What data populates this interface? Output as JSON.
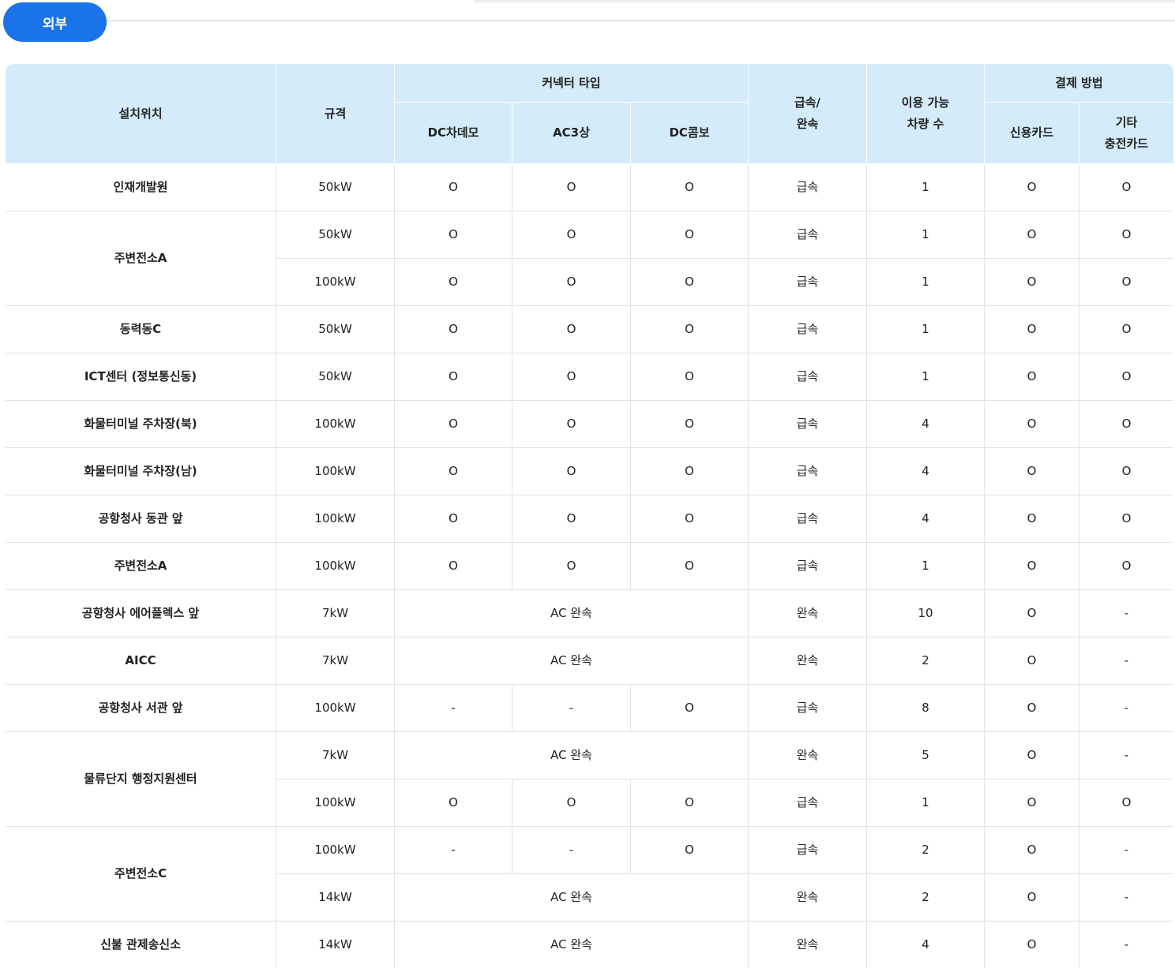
{
  "tab": {
    "label": "외부"
  },
  "table": {
    "headers": {
      "location": "설치위치",
      "spec": "규격",
      "connector_group": "커넥터 타입",
      "dc_chademo": "DC차데모",
      "ac3": "AC3상",
      "dc_combo": "DC콤보",
      "speed_line1": "급속/",
      "speed_line2": "완속",
      "capacity_line1": "이용 가능",
      "capacity_line2": "차량 수",
      "payment_group": "결제 방법",
      "credit_card": "신용카드",
      "other_card_line1": "기타",
      "other_card_line2": "충전카드"
    },
    "groups": [
      {
        "location": "인재개발원",
        "rows": [
          {
            "spec": "50kW",
            "dc_chademo": "O",
            "ac3": "O",
            "dc_combo": "O",
            "speed": "급속",
            "capacity": "1",
            "credit": "O",
            "other": "O"
          }
        ]
      },
      {
        "location": "주변전소A",
        "rows": [
          {
            "spec": "50kW",
            "dc_chademo": "O",
            "ac3": "O",
            "dc_combo": "O",
            "speed": "급속",
            "capacity": "1",
            "credit": "O",
            "other": "O"
          },
          {
            "spec": "100kW",
            "dc_chademo": "O",
            "ac3": "O",
            "dc_combo": "O",
            "speed": "급속",
            "capacity": "1",
            "credit": "O",
            "other": "O"
          }
        ]
      },
      {
        "location": "동력동C",
        "rows": [
          {
            "spec": "50kW",
            "dc_chademo": "O",
            "ac3": "O",
            "dc_combo": "O",
            "speed": "급속",
            "capacity": "1",
            "credit": "O",
            "other": "O"
          }
        ]
      },
      {
        "location": "ICT센터 (정보통신동)",
        "rows": [
          {
            "spec": "50kW",
            "dc_chademo": "O",
            "ac3": "O",
            "dc_combo": "O",
            "speed": "급속",
            "capacity": "1",
            "credit": "O",
            "other": "O"
          }
        ]
      },
      {
        "location": "화물터미널 주차장(북)",
        "rows": [
          {
            "spec": "100kW",
            "dc_chademo": "O",
            "ac3": "O",
            "dc_combo": "O",
            "speed": "급속",
            "capacity": "4",
            "credit": "O",
            "other": "O"
          }
        ]
      },
      {
        "location": "화물터미널 주차장(남)",
        "rows": [
          {
            "spec": "100kW",
            "dc_chademo": "O",
            "ac3": "O",
            "dc_combo": "O",
            "speed": "급속",
            "capacity": "4",
            "credit": "O",
            "other": "O"
          }
        ]
      },
      {
        "location": "공항청사 동관 앞",
        "rows": [
          {
            "spec": "100kW",
            "dc_chademo": "O",
            "ac3": "O",
            "dc_combo": "O",
            "speed": "급속",
            "capacity": "4",
            "credit": "O",
            "other": "O"
          }
        ]
      },
      {
        "location": "주변전소A",
        "rows": [
          {
            "spec": "100kW",
            "dc_chademo": "O",
            "ac3": "O",
            "dc_combo": "O",
            "speed": "급속",
            "capacity": "1",
            "credit": "O",
            "other": "O"
          }
        ]
      },
      {
        "location": "공항청사 에어플렉스 앞",
        "rows": [
          {
            "spec": "7kW",
            "connector_merged": "AC 완속",
            "speed": "완속",
            "capacity": "10",
            "credit": "O",
            "other": "-"
          }
        ]
      },
      {
        "location": "AICC",
        "rows": [
          {
            "spec": "7kW",
            "connector_merged": "AC 완속",
            "speed": "완속",
            "capacity": "2",
            "credit": "O",
            "other": "-"
          }
        ]
      },
      {
        "location": "공항청사 서관 앞",
        "rows": [
          {
            "spec": "100kW",
            "dc_chademo": "-",
            "ac3": "-",
            "dc_combo": "O",
            "speed": "급속",
            "capacity": "8",
            "credit": "O",
            "other": "-"
          }
        ]
      },
      {
        "location": "물류단지 행정지원센터",
        "rows": [
          {
            "spec": "7kW",
            "connector_merged": "AC 완속",
            "speed": "완속",
            "capacity": "5",
            "credit": "O",
            "other": "-"
          },
          {
            "spec": "100kW",
            "dc_chademo": "O",
            "ac3": "O",
            "dc_combo": "O",
            "speed": "급속",
            "capacity": "1",
            "credit": "O",
            "other": "O"
          }
        ]
      },
      {
        "location": "주변전소C",
        "rows": [
          {
            "spec": "100kW",
            "dc_chademo": "-",
            "ac3": "-",
            "dc_combo": "O",
            "speed": "급속",
            "capacity": "2",
            "credit": "O",
            "other": "-"
          },
          {
            "spec": "14kW",
            "connector_merged": "AC 완속",
            "speed": "완속",
            "capacity": "2",
            "credit": "O",
            "other": "-"
          }
        ]
      },
      {
        "location": "신불 관제송신소",
        "rows": [
          {
            "spec": "14kW",
            "connector_merged": "AC 완속",
            "speed": "완속",
            "capacity": "4",
            "credit": "O",
            "other": "-"
          }
        ]
      }
    ]
  }
}
